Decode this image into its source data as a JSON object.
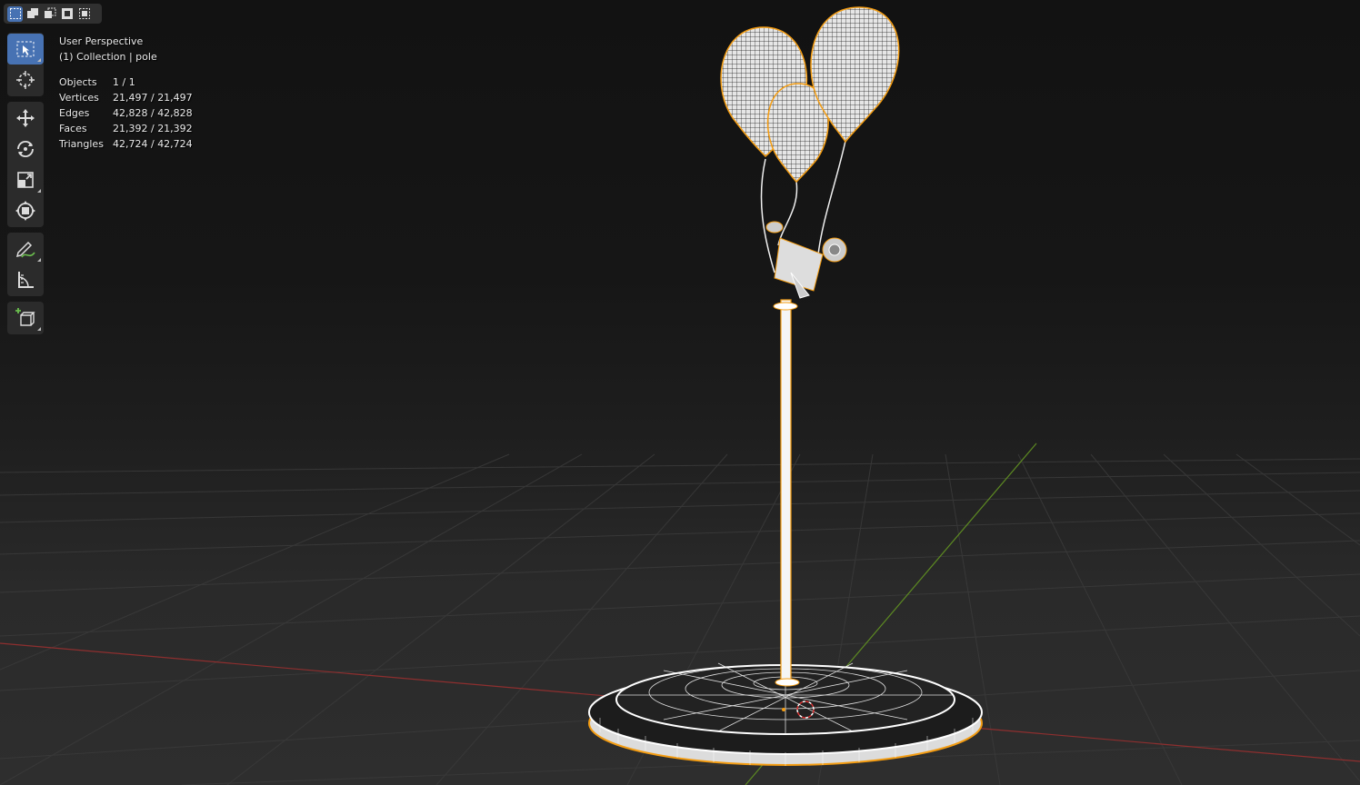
{
  "viewport": {
    "view_name": "User Perspective",
    "collection_info": "(1) Collection | pole"
  },
  "stats": [
    {
      "label": "Objects",
      "value": "1 / 1"
    },
    {
      "label": "Vertices",
      "value": "21,497 / 21,497"
    },
    {
      "label": "Edges",
      "value": "42,828 / 42,828"
    },
    {
      "label": "Faces",
      "value": "21,392 / 21,392"
    },
    {
      "label": "Triangles",
      "value": "42,724 / 42,724"
    }
  ],
  "header": {
    "select_modes": [
      {
        "icon": "select-new-icon",
        "active": true
      },
      {
        "icon": "select-extend-icon",
        "active": false
      },
      {
        "icon": "select-subtract-icon",
        "active": false
      },
      {
        "icon": "select-invert-icon",
        "active": false
      },
      {
        "icon": "select-intersect-icon",
        "active": false
      }
    ]
  },
  "toolbar": {
    "tools": [
      {
        "icon": "select-box-icon",
        "active": true
      },
      {
        "icon": "cursor-icon",
        "active": false
      },
      {
        "icon": "move-icon",
        "active": false
      },
      {
        "icon": "rotate-icon",
        "active": false
      },
      {
        "icon": "scale-icon",
        "active": false
      },
      {
        "icon": "transform-icon",
        "active": false
      },
      {
        "icon": "annotate-icon",
        "active": false
      },
      {
        "icon": "measure-icon",
        "active": false
      },
      {
        "icon": "add-cube-icon",
        "active": false
      }
    ]
  },
  "colors": {
    "selection_outline": "#f39c12",
    "active_tool": "#4772b3",
    "x_axis": "#a33b3b",
    "y_axis": "#6a9a2a",
    "wireframe": "#ffffff"
  }
}
